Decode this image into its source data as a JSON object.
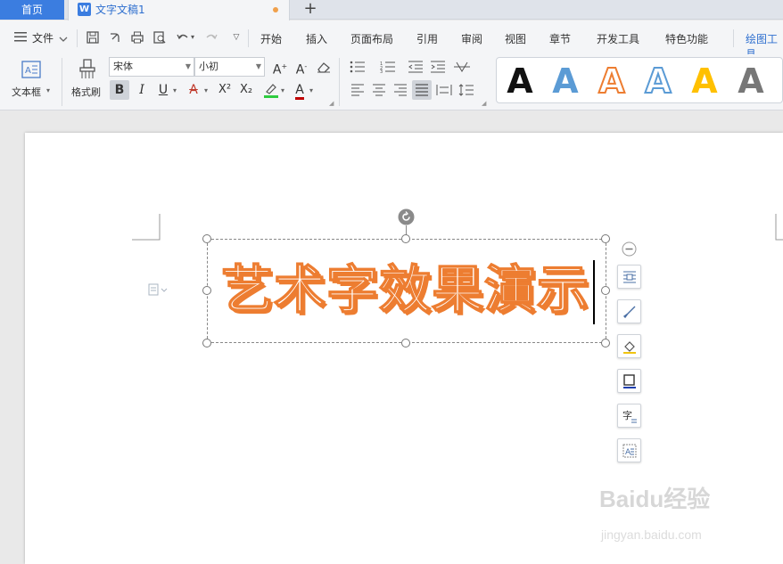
{
  "tabs": {
    "home": "首页",
    "document": "文字文稿1",
    "plus": "+"
  },
  "menu": {
    "file": "文件",
    "items": [
      "开始",
      "插入",
      "页面布局",
      "引用",
      "审阅",
      "视图",
      "章节",
      "开发工具",
      "特色功能",
      "绘图工具"
    ]
  },
  "ribbon": {
    "textbox_label": "文本框",
    "format_painter_label": "格式刷",
    "font_name": "宋体",
    "font_size": "小初",
    "bold": "B",
    "italic": "I",
    "underline": "U",
    "strike": "A",
    "superscript": "X²",
    "subscript": "X₂",
    "font_color": "A",
    "wordart_styles": [
      "A",
      "A",
      "A",
      "A",
      "A",
      "A"
    ]
  },
  "document": {
    "art_text": "艺术字效果演示"
  },
  "watermark": {
    "brand": "Baidu经验",
    "url": "jingyan.baidu.com"
  },
  "colors": {
    "accent_blue": "#3b7de0",
    "art_orange": "#ed7d31"
  }
}
